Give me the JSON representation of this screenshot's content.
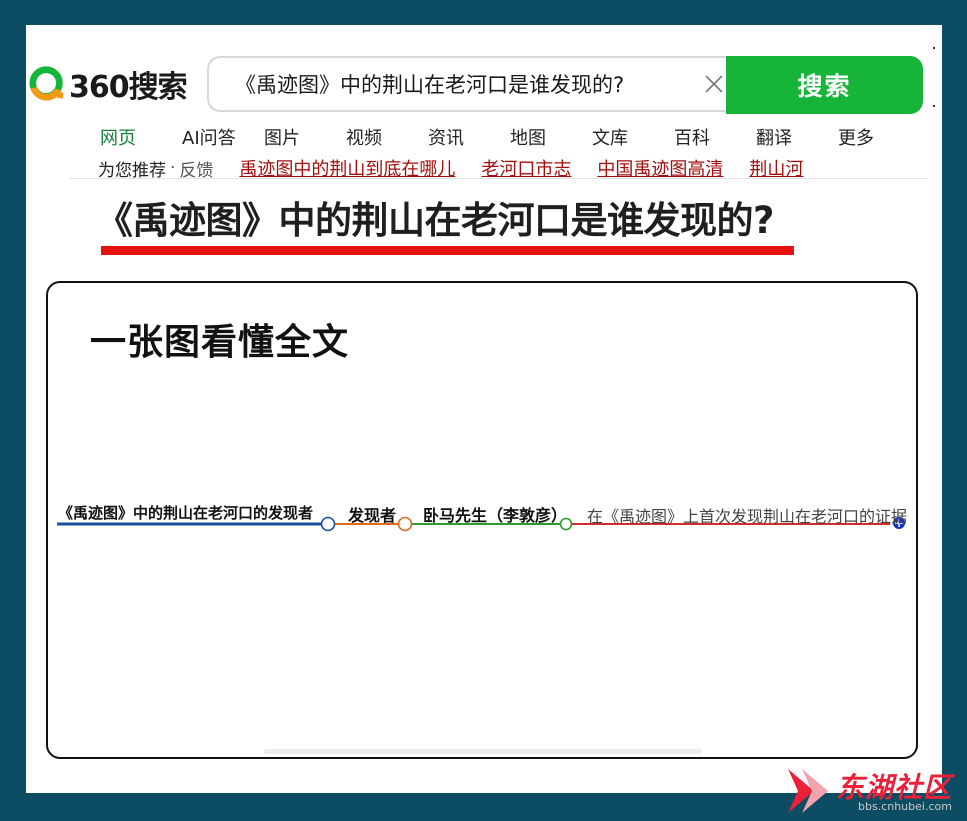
{
  "header": {
    "logo_text": "360搜索",
    "search_query": "《禹迹图》中的荆山在老河口是谁发现的?",
    "search_button_label": "搜索"
  },
  "nav": {
    "items": [
      {
        "label": "网页",
        "active": true
      },
      {
        "label": "AI问答",
        "active": false
      },
      {
        "label": "图片",
        "active": false
      },
      {
        "label": "视频",
        "active": false
      },
      {
        "label": "资讯",
        "active": false
      },
      {
        "label": "地图",
        "active": false
      },
      {
        "label": "文库",
        "active": false
      },
      {
        "label": "百科",
        "active": false
      },
      {
        "label": "翻译",
        "active": false
      },
      {
        "label": "更多",
        "active": false
      }
    ]
  },
  "recommend": {
    "label": "为您推荐",
    "separator": "·",
    "feedback": "反馈",
    "links": [
      "禹迹图中的荆山到底在哪儿",
      "老河口市志",
      "中国禹迹图高清",
      "荆山河"
    ]
  },
  "headline": "《禹迹图》中的荆山在老河口是谁发现的?",
  "card": {
    "title": "一张图看懂全文",
    "mindmap": {
      "nodes": [
        {
          "label": "《禹迹图》中的荆山在老河口的发现者",
          "color": "#1c4ea4"
        },
        {
          "label": "发现者",
          "color": "#e06a1e"
        },
        {
          "label": "卧马先生（李敦彦）",
          "color": "#2f9a2f"
        },
        {
          "label": "在《禹迹图》上首次发现荆山在老河口的证据",
          "color": "#d42b2b"
        }
      ],
      "end_node_color": "#1533c9"
    }
  },
  "watermark": {
    "text": "东湖社区",
    "url": "bbs.cnhubei.com"
  },
  "colors": {
    "brand_green": "#16b53a",
    "link_red": "#a50d0d",
    "underline_red": "#e81111",
    "frame": "#0c4d63"
  }
}
